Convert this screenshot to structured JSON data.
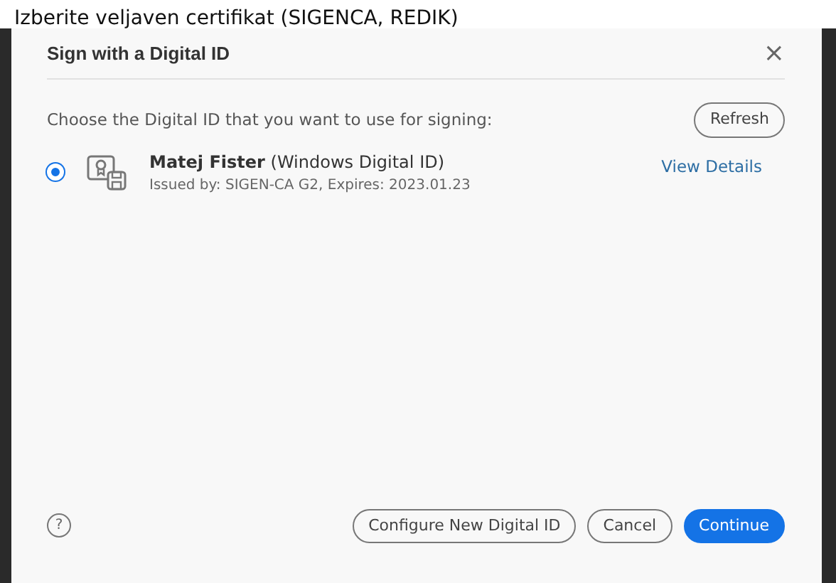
{
  "caption": "Izberite veljaven certifikat (SIGENCA, REDIK)",
  "dialog": {
    "title": "Sign with a Digital ID",
    "close": "×",
    "prompt": "Choose the Digital ID that you want to use for signing:",
    "refresh": "Refresh",
    "ids": [
      {
        "name": "Matej Fister",
        "type": "(Windows Digital ID)",
        "issued": "Issued by: SIGEN-CA G2, Expires: 2023.01.23",
        "link": "View Details",
        "selected": true
      }
    ],
    "help": "?",
    "buttons": [
      {
        "label": "Configure New Digital ID",
        "kind": "outline"
      },
      {
        "label": "Cancel",
        "kind": "outline"
      },
      {
        "label": "Continue",
        "kind": "primary"
      }
    ]
  }
}
